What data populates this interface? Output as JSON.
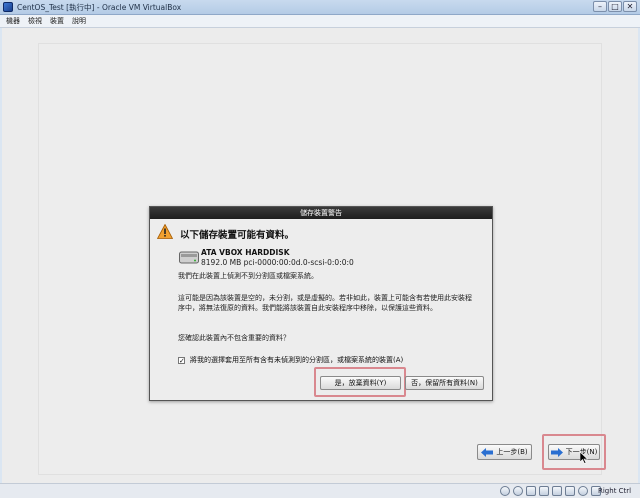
{
  "window": {
    "title": "CentOS_Test [執行中] - Oracle VM VirtualBox",
    "controls": {
      "minimize": "–",
      "maximize": "□",
      "close": "✕"
    }
  },
  "menu": [
    "機器",
    "檢視",
    "裝置",
    "說明"
  ],
  "dialog": {
    "title": "儲存裝置警告",
    "heading": "以下儲存裝置可能有資料。",
    "disk_name": "ATA VBOX HARDDISK",
    "disk_info": "8192.0 MB   pci-0000:00:0d.0-scsi-0:0:0:0",
    "paragraph1": "我們在此裝置上偵測不到分割區或檔案系統。",
    "paragraph2": "這可能是因為該裝置是空的，未分割，或是虛擬的。若非如此，裝置上可能含有若使用此安裝程序中，將無法復原的資料。我們能將該裝置自此安裝程序中移除，以保護這些資料。",
    "paragraph3": "您確認此裝置內不包含重要的資料？",
    "checkbox_label": "將我的選擇套用至所有含有未偵測到的分割區，或檔案系統的裝置(A)",
    "checkbox_checked": true,
    "yes_button": "是，放棄資料(Y)",
    "no_button": "否，保留所有資料(N)"
  },
  "navigation": {
    "back_button": "上一步(B)",
    "next_button": "下一步(N)"
  },
  "statusbar": {
    "host_key": "Right Ctrl"
  },
  "colors": {
    "highlight": "#d9888f",
    "dialog_titlebar": "#2a2a2a",
    "arrow_blue": "#2a6fd1"
  }
}
